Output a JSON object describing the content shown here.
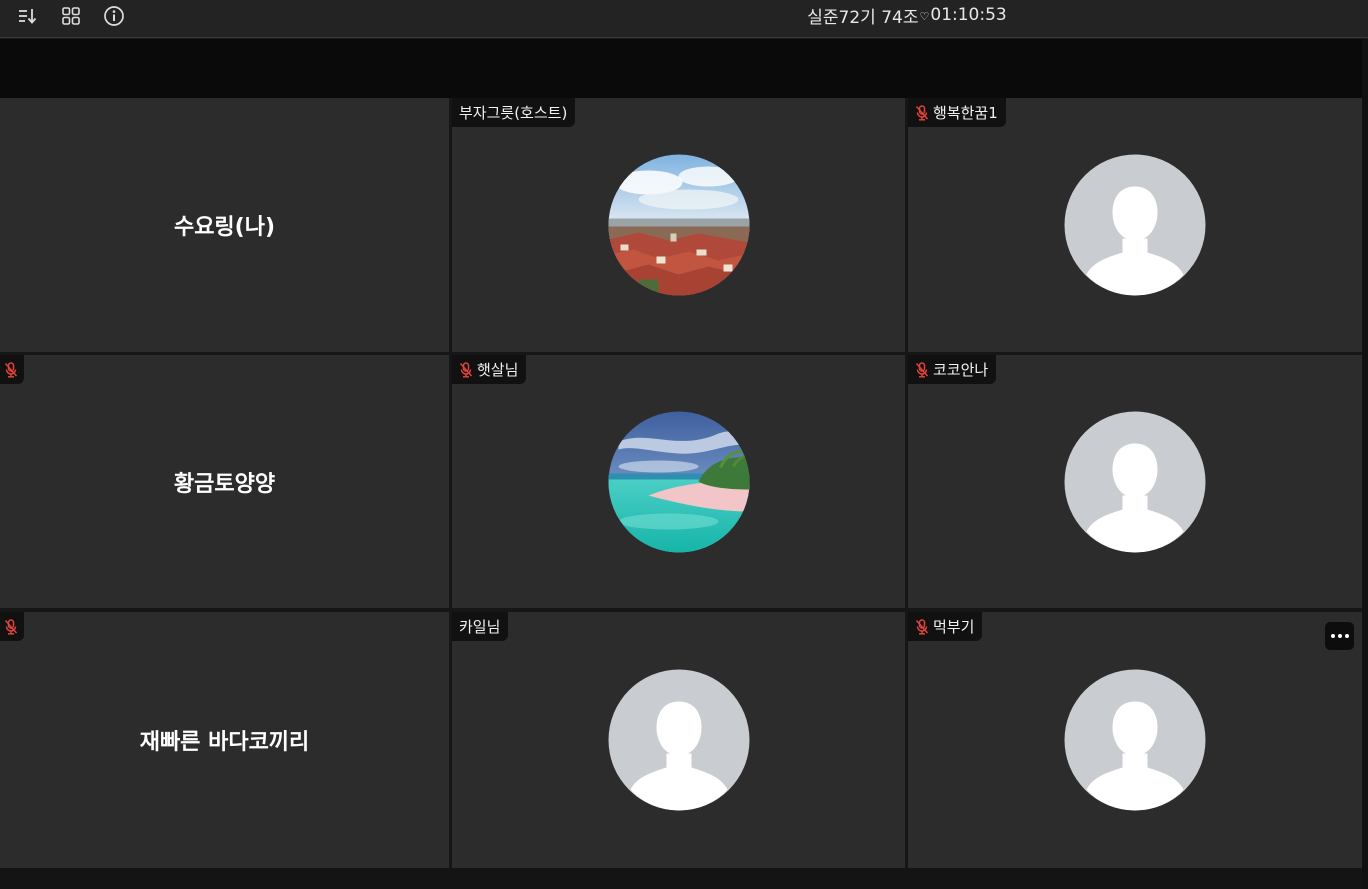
{
  "toolbar": {
    "icons": [
      "sort-icon",
      "grid-view-icon",
      "info-icon"
    ],
    "meeting_title_prefix": "실준72기 74조",
    "heart_glyph": "♡",
    "elapsed_time": "01:10:53"
  },
  "participants": [
    {
      "name": "수요링(나)",
      "display": "name-text",
      "muted": false,
      "tag": ""
    },
    {
      "name": "부자그릇(호스트)",
      "display": "photo-city",
      "muted": false,
      "tag": "부자그릇(호스트)"
    },
    {
      "name": "행복한꿈1",
      "display": "default-avatar",
      "muted": true,
      "tag": "행복한꿈1"
    },
    {
      "name": "황금토양양",
      "display": "name-text",
      "muted": true,
      "tag": ""
    },
    {
      "name": "햇살님",
      "display": "photo-beach",
      "muted": true,
      "tag": "햇살님"
    },
    {
      "name": "코코안나",
      "display": "default-avatar",
      "muted": true,
      "tag": "코코안나"
    },
    {
      "name": "재빠른 바다코끼리",
      "display": "name-text",
      "muted": true,
      "tag": ""
    },
    {
      "name": "카일님",
      "display": "default-avatar",
      "muted": false,
      "tag": "카일님"
    },
    {
      "name": "먹부기",
      "display": "default-avatar",
      "muted": true,
      "tag": "먹부기",
      "more_menu": true
    }
  ],
  "colors": {
    "tile_bg": "#2c2c2c",
    "muted_mic": "#e0443a",
    "avatar_bg": "#c9ccd1"
  }
}
